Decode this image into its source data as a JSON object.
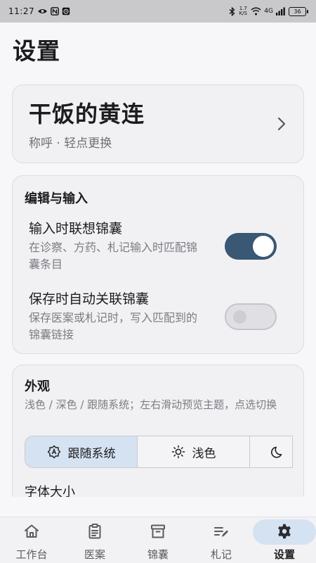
{
  "status_bar": {
    "time": "11:27",
    "network_speed": "1.7 K/S",
    "network_type": "4G",
    "battery": "36"
  },
  "page": {
    "title": "设置"
  },
  "profile": {
    "name": "干饭的黄连",
    "hint": "称呼 · 轻点更换"
  },
  "edit_section": {
    "title": "编辑与输入",
    "items": [
      {
        "title": "输入时联想锦囊",
        "description": "在诊察、方药、札记输入时匹配锦囊条目",
        "enabled": true
      },
      {
        "title": "保存时自动关联锦囊",
        "description": "保存医案或札记时，写入匹配到的锦囊链接",
        "enabled": false
      }
    ]
  },
  "appearance": {
    "title": "外观",
    "description": "浅色 / 深色 / 跟随系统；左右滑动预览主题，点选切换",
    "themes": [
      {
        "label": "跟随系统",
        "icon": "auto-theme-icon",
        "selected": true
      },
      {
        "label": "浅色",
        "icon": "sun-icon",
        "selected": false
      },
      {
        "label": "",
        "icon": "moon-icon",
        "selected": false
      }
    ],
    "font_size_label": "字体大小"
  },
  "nav": {
    "items": [
      {
        "label": "工作台",
        "icon": "home-icon",
        "active": false
      },
      {
        "label": "医案",
        "icon": "clipboard-icon",
        "active": false
      },
      {
        "label": "锦囊",
        "icon": "archive-box-icon",
        "active": false
      },
      {
        "label": "札记",
        "icon": "note-icon",
        "active": false
      },
      {
        "label": "设置",
        "icon": "gear-icon",
        "active": true
      }
    ]
  },
  "colors": {
    "accent": "#3a5773",
    "selected_bg": "#d5e2f2",
    "card_bg": "#f1f1f4"
  }
}
